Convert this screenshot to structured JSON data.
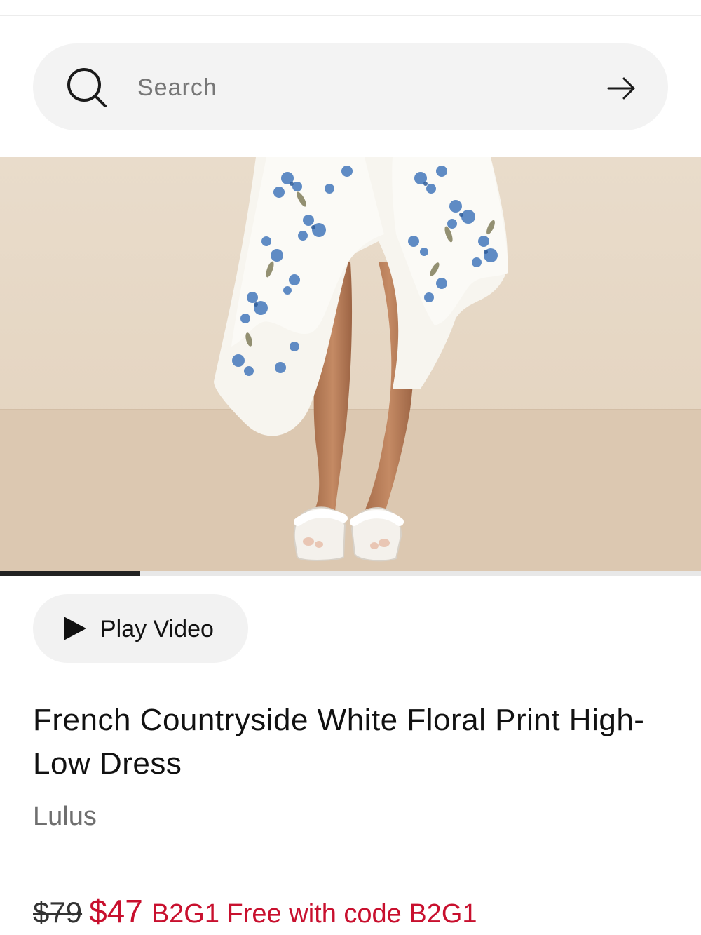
{
  "search": {
    "placeholder": "Search"
  },
  "media": {
    "image_alt": "Model wearing white floral print high-low dress with white sandals",
    "progress_fraction": 0.2,
    "play_video_label": "Play Video"
  },
  "product": {
    "title": "French Countryside White Floral Print High-Low Dress",
    "brand": "Lulus",
    "original_price": "$79",
    "sale_price": "$47",
    "promo": "B2G1 Free with code B2G1"
  },
  "colors": {
    "sale_red": "#c8102e",
    "search_bg": "#f3f3f3",
    "backdrop": "#e6d6c3",
    "dress_blue": "#4f7fbf"
  },
  "icons": {
    "search": "search-icon",
    "submit": "arrow-right-icon",
    "play": "play-icon"
  }
}
